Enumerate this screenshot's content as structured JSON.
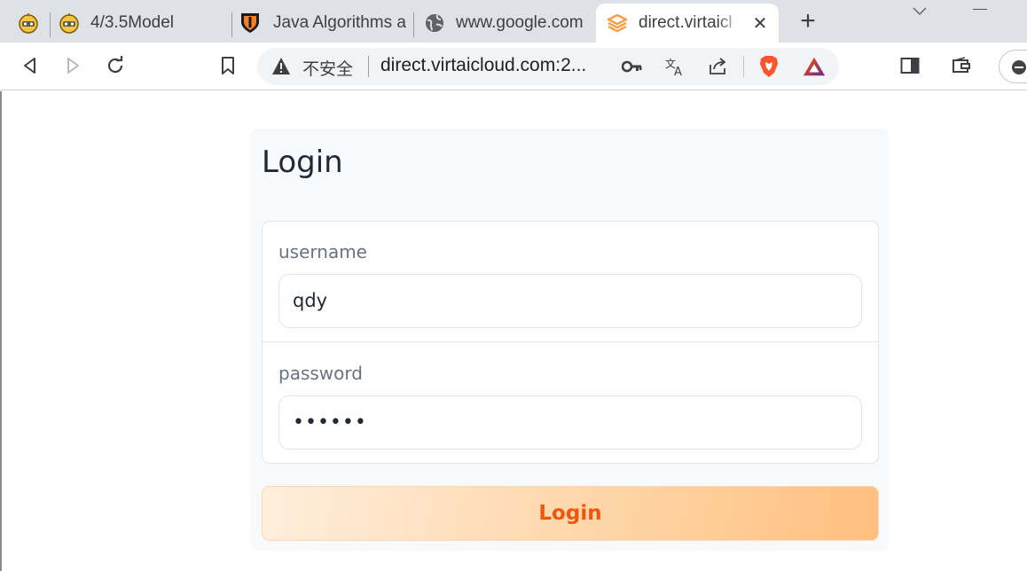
{
  "browser": {
    "tabs": [
      {
        "label": "",
        "icon": "robot-favicon-icon",
        "active": false
      },
      {
        "label": "4/3.5Model",
        "icon": "robot-favicon-icon",
        "active": false
      },
      {
        "label": "Java Algorithms a",
        "icon": "shield-crest-favicon-icon",
        "active": false
      },
      {
        "label": "www.google.com",
        "icon": "globe-icon",
        "active": false
      },
      {
        "label": "direct.virtaicl",
        "icon": "layers-favicon-icon",
        "active": true
      }
    ],
    "new_tab_label": "+",
    "close_tab_label": "✕"
  },
  "omnibox": {
    "security_text": "不安全",
    "url": "direct.virtaicloud.com:2..."
  },
  "page": {
    "title": "Login",
    "username_label": "username",
    "username_value": "qdy",
    "password_label": "password",
    "password_value": "••••••",
    "submit_label": "Login"
  },
  "colors": {
    "accent": "#ea580c",
    "button_gradient_start": "#ffeedd",
    "button_gradient_end": "#ffbf80",
    "brave_orange": "#fb542b"
  }
}
